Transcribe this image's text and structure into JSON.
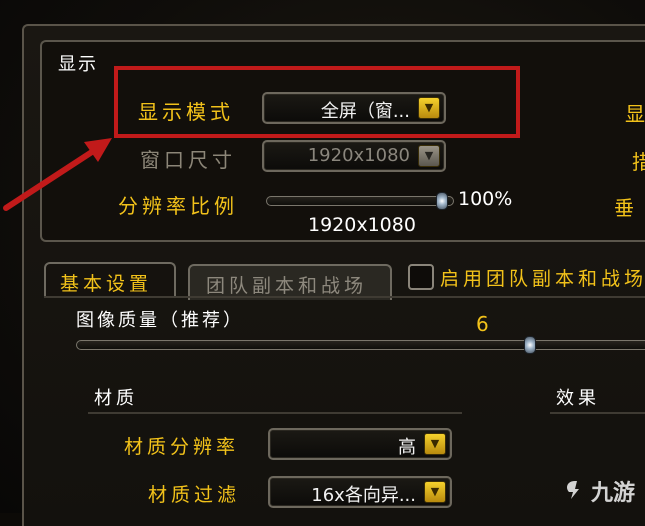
{
  "display": {
    "section_title": "显示",
    "display_mode_label": "显示模式",
    "display_mode_value": "全屏（窗...",
    "window_size_label": "窗口尺寸",
    "window_size_value": "1920x1080",
    "resolution_scale_label": "分辨率比例",
    "resolution_scale_value": "100%",
    "resolution_scale_level": 1.0,
    "resolution_result": "1920x1080",
    "right_edge_chars": [
      "显",
      "措",
      "垂"
    ]
  },
  "tabs": [
    {
      "label": "基本设置",
      "active": true
    },
    {
      "label": "团队副本和战场",
      "active": false
    }
  ],
  "raid_checkbox_label": "启用团队副本和战场",
  "graphics_quality": {
    "label": "图像质量（推荐）",
    "value": "6",
    "level": 0.6
  },
  "texture_section": {
    "title": "材质",
    "effects_title": "效果",
    "resolution_label": "材质分辨率",
    "resolution_value": "高",
    "filter_label": "材质过滤",
    "filter_value": "16x各向异..."
  },
  "watermark": "九游",
  "colors": {
    "accent_gold": "#f2c21a",
    "highlight_red": "#c11a1a",
    "disabled_grey": "#8c8678"
  }
}
